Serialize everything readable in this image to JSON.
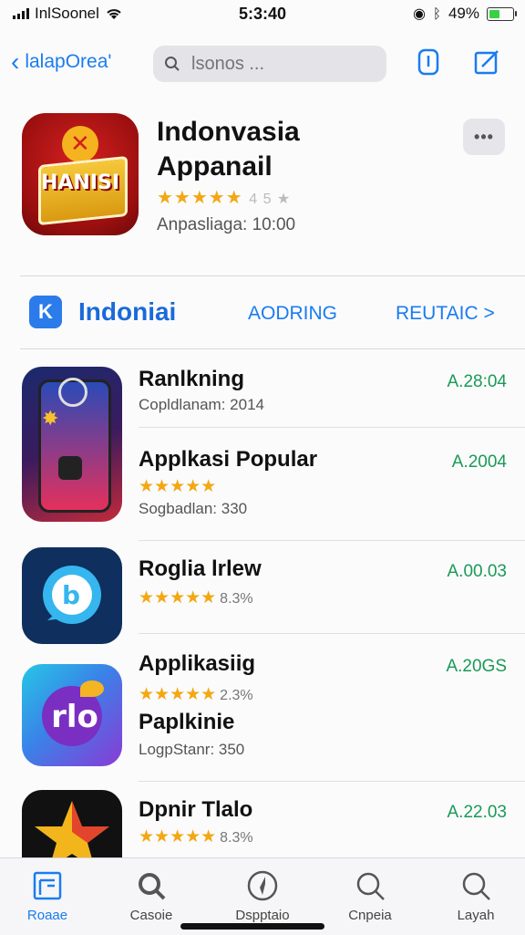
{
  "status": {
    "carrier": "InlSoonel",
    "time": "5:3:40",
    "battery": "49%",
    "battery_level": 0.49
  },
  "nav": {
    "back_label": "lalapOrea'",
    "search_placeholder": "lsonos ..."
  },
  "hero": {
    "icon_text": "HANISI",
    "title_line1": "Indonvasia",
    "title_line2": "Appanail",
    "stars": "★★★★★",
    "rating_suffix": "4 5 ★",
    "meta": "Anpasliaga: 10:00",
    "more_label": "•••"
  },
  "tabs": {
    "main": "Indoniai",
    "b": "AODRING",
    "c": "REUTAIC >",
    "logo": "K"
  },
  "apps": [
    {
      "name": "Ranlkning",
      "sub": "Copldlanam: 2014",
      "price": "A.28:04",
      "stars": "",
      "pct": ""
    },
    {
      "name": "Applkasi Popular",
      "sub": "Sogbadlan: 330",
      "price": "A.2004",
      "stars": "★★★★★",
      "pct": ""
    },
    {
      "name": "Roglia lrlew",
      "sub": "",
      "price": "A.00.03",
      "stars": "★★★★★",
      "pct": "8.3%"
    },
    {
      "name": "Applikasiig",
      "name2": "Paplkinie",
      "sub": "LogpStanr: 350",
      "price": "A.20GS",
      "stars": "★★★★★",
      "pct": "2.3%",
      "icon_text": "rlo"
    },
    {
      "name": "Dpnir Tlalo",
      "sub": "",
      "price": "A.22.03",
      "stars": "★★★★★",
      "pct": "8.3%"
    }
  ],
  "tabbar": [
    {
      "label": "Roaae",
      "icon": "apps-grid-icon"
    },
    {
      "label": "Casoie",
      "icon": "search-icon"
    },
    {
      "label": "Dspptaio",
      "icon": "compass-icon"
    },
    {
      "label": "Cnpeia",
      "icon": "search-icon"
    },
    {
      "label": "Layah",
      "icon": "search-icon"
    }
  ]
}
